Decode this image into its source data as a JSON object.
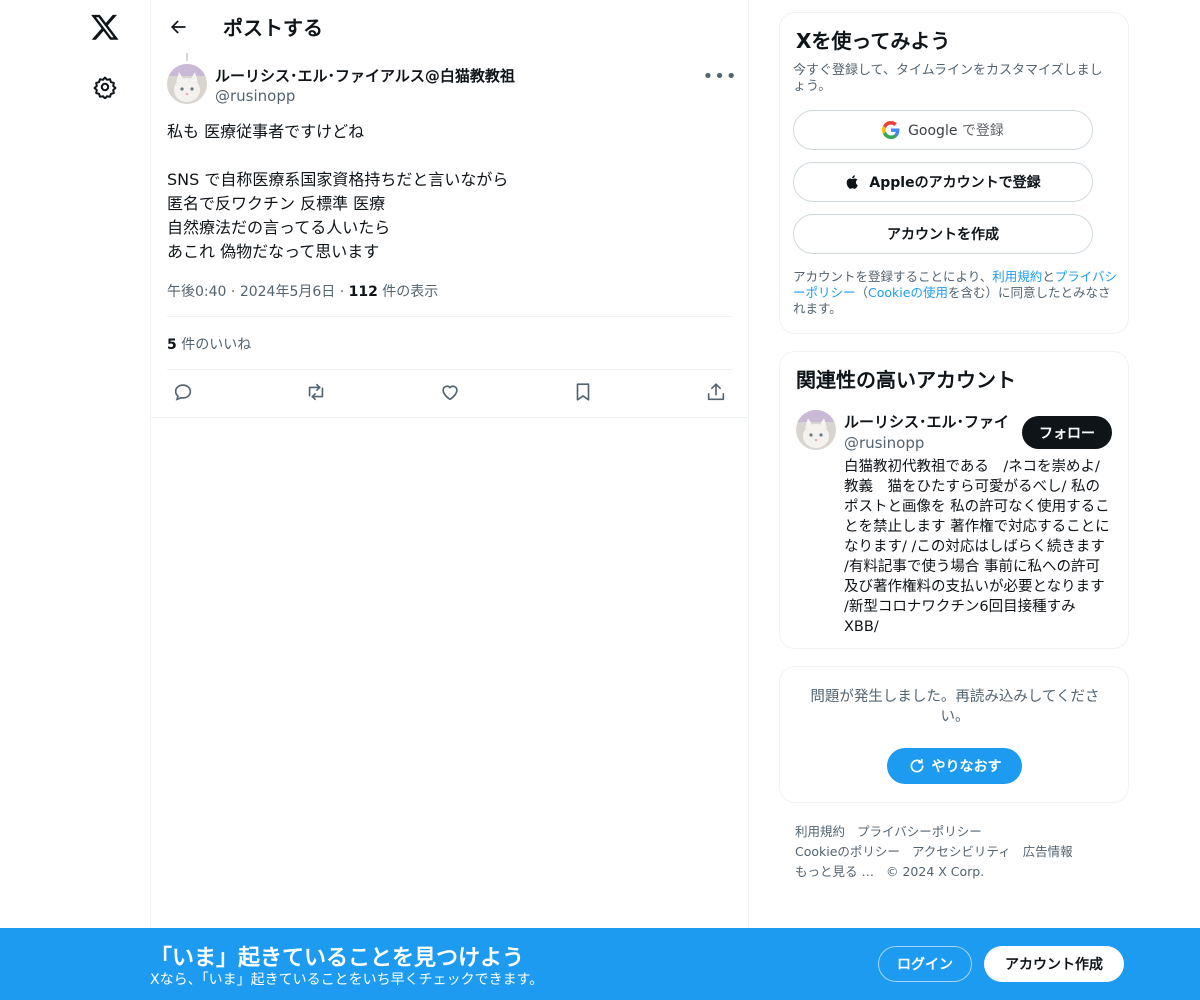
{
  "nav": {
    "logo": "x-logo-icon",
    "settings": "gear-icon"
  },
  "header": {
    "title": "ポストする"
  },
  "post": {
    "author_name": "ルーリシス･エル･ファイアルス@白猫教教祖",
    "author_handle": "@rusinopp",
    "text": "私も 医療従事者ですけどね\n\nSNS で自称医療系国家資格持ちだと言いながら\n匿名で反ワクチン 反標準 医療\n自然療法だの言ってる人いたら\nあこれ 偽物だなって思います",
    "time": "午後0:40",
    "date": "2024年5月6日",
    "views_count": "112",
    "views_label": " 件の表示",
    "likes_count": "5",
    "likes_label": " 件のいいね"
  },
  "signup_card": {
    "title": "Xを使ってみよう",
    "subtitle": "今すぐ登録して、タイムラインをカスタマイズしましょう。",
    "google_brand": "Google",
    "google_suffix": " で登録",
    "apple_label": "Appleのアカウントで登録",
    "create_label": "アカウントを作成",
    "legal_1": "アカウントを登録することにより、",
    "legal_terms": "利用規約",
    "legal_2": "と",
    "legal_privacy": "プライバシーポリシー",
    "legal_3": "（",
    "legal_cookie": "Cookieの使用",
    "legal_4": "を含む）に同意したとみなされます。"
  },
  "related": {
    "title": "関連性の高いアカウント",
    "name": "ルーリシス･エル･ファイ",
    "handle": "@rusinopp",
    "follow_label": "フォロー",
    "bio": "白猫教初代教祖である　/ネコを崇めよ/ 教義　猫をひたすら可愛がるべし/ 私のポストと画像を 私の許可なく使用することを禁止します 著作権で対応することになります/ /この対応はしばらく続きます /有料記事で使う場合 事前に私への許可及び著作権料の支払いが必要となります /新型コロナワクチン6回目接種すみ XBB/"
  },
  "error_card": {
    "message": "問題が発生しました。再読み込みしてください。",
    "retry_label": "やりなおす"
  },
  "footer": {
    "links": [
      "利用規約",
      "プライバシーポリシー",
      "Cookieのポリシー",
      "アクセシビリティ",
      "広告情報",
      "もっと見る …",
      "© 2024 X Corp."
    ]
  },
  "banner": {
    "title": "「いま」起きていることを見つけよう",
    "subtitle": "Xなら、「いま」起きていることをいち早くチェックできます。",
    "login_label": "ログイン",
    "signup_label": "アカウント作成"
  },
  "colors": {
    "accent": "#1d9bf0",
    "text": "#0f1419",
    "secondary": "#536471"
  }
}
